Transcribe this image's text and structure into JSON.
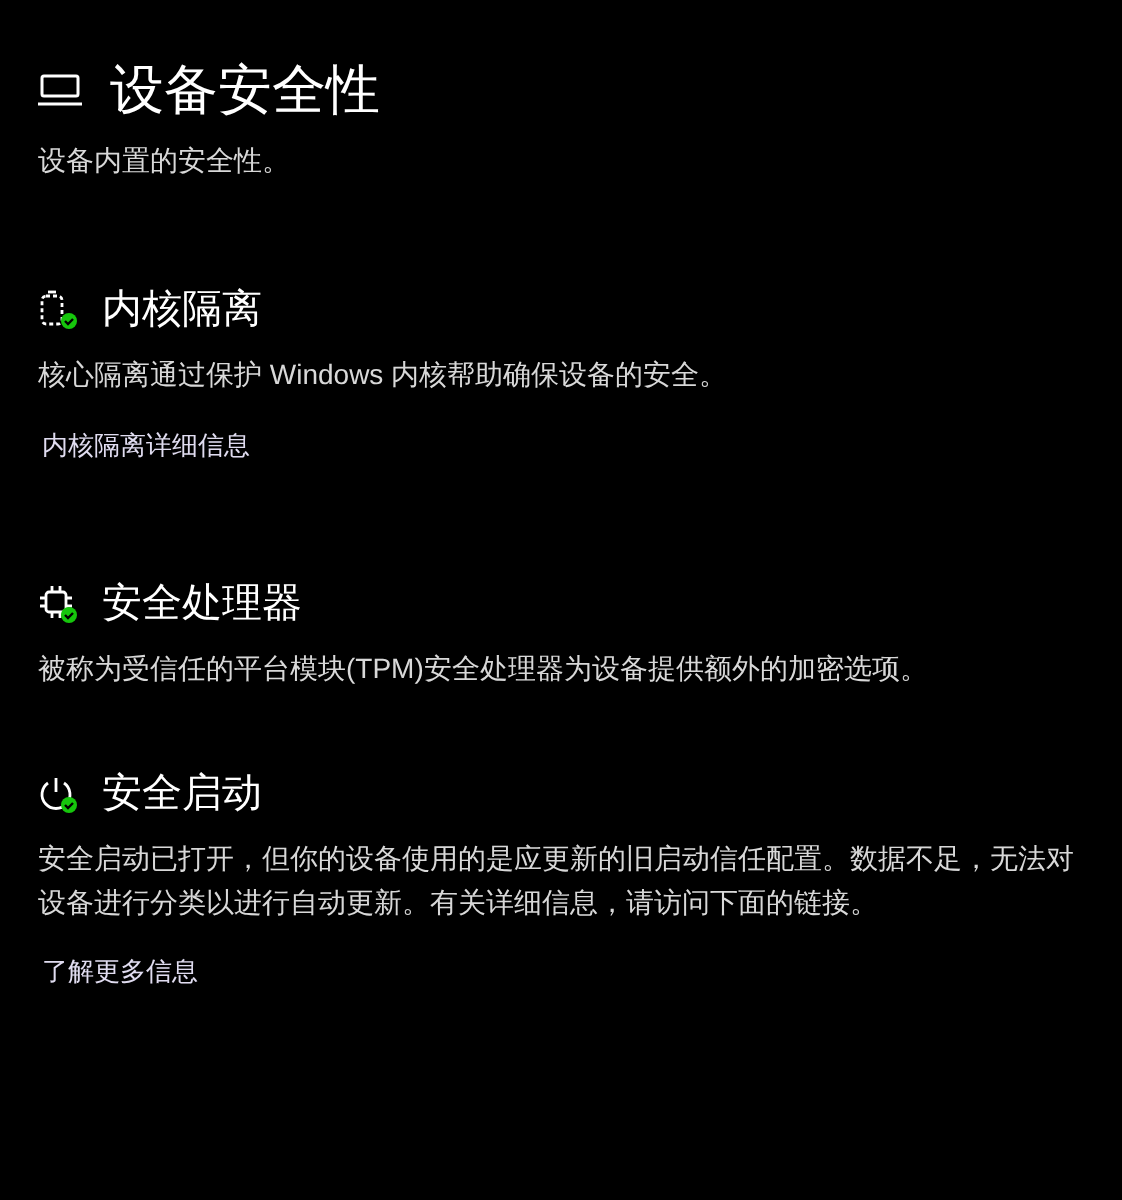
{
  "page": {
    "title": "设备安全性",
    "subtitle": "设备内置的安全性。"
  },
  "sections": [
    {
      "kind": "isolation",
      "protected": true,
      "title": "内核隔离",
      "description": "核心隔离通过保护 Windows 内核帮助确保设备的安全。",
      "link": "内核隔离详细信息"
    },
    {
      "kind": "processor",
      "protected": true,
      "title": "安全处理器",
      "description": "被称为受信任的平台模块(TPM)安全处理器为设备提供额外的加密选项。"
    },
    {
      "kind": "boot",
      "protected": true,
      "title": "安全启动",
      "description": "安全启动已打开，但你的设备使用的是应更新的旧启动信任配置。数据不足，无法对设备进行分类以进行自动更新。有关详细信息，请访问下面的链接。",
      "link": "了解更多信息"
    }
  ]
}
